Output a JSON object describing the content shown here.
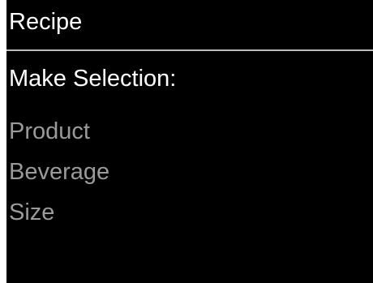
{
  "header": {
    "title": "Recipe"
  },
  "main": {
    "prompt": "Make Selection:",
    "options": [
      {
        "label": "Product"
      },
      {
        "label": "Beverage"
      },
      {
        "label": "Size"
      }
    ]
  },
  "colors": {
    "background": "#000000",
    "text_primary": "#ffffff",
    "text_inactive": "#9a9a9a",
    "divider": "#bdbdbd"
  }
}
